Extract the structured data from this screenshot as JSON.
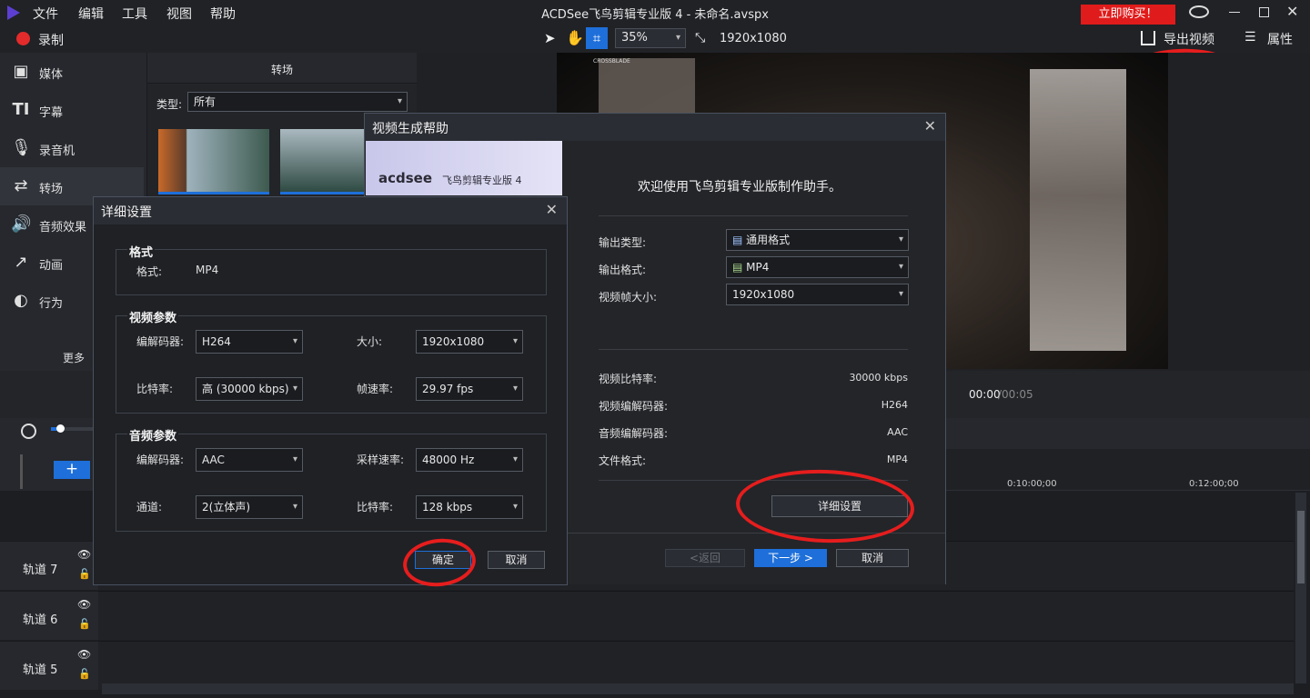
{
  "app": {
    "menu": [
      "文件",
      "编辑",
      "工具",
      "视图",
      "帮助"
    ],
    "title": "ACDSee飞鸟剪辑专业版 4 - 未命名.avspx",
    "buy_label": "立即购买！"
  },
  "toolbar": {
    "record_label": "录制",
    "zoom": "35%",
    "resolution": "1920x1080",
    "export_label": "导出视频",
    "properties_label": "属性"
  },
  "leftnav": {
    "items": [
      {
        "label": "媒体",
        "icon": "media-icon"
      },
      {
        "label": "字幕",
        "icon": "caption-icon"
      },
      {
        "label": "录音机",
        "icon": "microphone-icon"
      },
      {
        "label": "转场",
        "icon": "transition-icon"
      },
      {
        "label": "音频效果",
        "icon": "audio-effect-icon"
      },
      {
        "label": "动画",
        "icon": "animation-icon"
      },
      {
        "label": "行为",
        "icon": "behavior-icon"
      }
    ],
    "more_label": "更多"
  },
  "transitions": {
    "header": "转场",
    "type_label": "类型:",
    "type_value": "所有"
  },
  "preview": {
    "time_current": "00:00",
    "time_total": "/00:05",
    "watermark": "CROSSBLADE"
  },
  "timeline": {
    "ruler": [
      "0:10:00;00",
      "0:12:00;00"
    ],
    "tracks": [
      "轨道 7",
      "轨道 6",
      "轨道 5"
    ]
  },
  "wizard": {
    "title": "视频生成帮助",
    "banner_brand": "acdsee",
    "banner_product": "飞鸟剪辑专业版 4",
    "welcome": "欢迎使用飞鸟剪辑专业版制作助手。",
    "output_type_label": "输出类型:",
    "output_type_value": "通用格式",
    "output_format_label": "输出格式:",
    "output_format_value": "MP4",
    "frame_size_label": "视频帧大小:",
    "frame_size_value": "1920x1080",
    "info": [
      {
        "label": "视频比特率:",
        "value": "30000 kbps"
      },
      {
        "label": "视频编解码器:",
        "value": "H264"
      },
      {
        "label": "音频编解码器:",
        "value": "AAC"
      },
      {
        "label": "文件格式:",
        "value": "MP4"
      }
    ],
    "detail_button": "详细设置",
    "back_button": "<返回",
    "next_button": "下一步 >",
    "cancel_button": "取消"
  },
  "details": {
    "title": "详细设置",
    "format_group": "格式",
    "format_label": "格式:",
    "format_value": "MP4",
    "video_group": "视频参数",
    "video_codec_label": "编解码器:",
    "video_codec_value": "H264",
    "size_label": "大小:",
    "size_value": "1920x1080",
    "bitrate_label": "比特率:",
    "bitrate_value": "高 (30000 kbps)",
    "framerate_label": "帧速率:",
    "framerate_value": "29.97 fps",
    "audio_group": "音频参数",
    "audio_codec_label": "编解码器:",
    "audio_codec_value": "AAC",
    "samplerate_label": "采样速率:",
    "samplerate_value": "48000 Hz",
    "channel_label": "通道:",
    "channel_value": "2(立体声)",
    "audio_bitrate_label": "比特率:",
    "audio_bitrate_value": "128 kbps",
    "ok_button": "确定",
    "cancel_button": "取消"
  },
  "colors": {
    "accent": "#1e6fd9",
    "annotation": "#e61d1d",
    "buy": "#e01b1b"
  }
}
